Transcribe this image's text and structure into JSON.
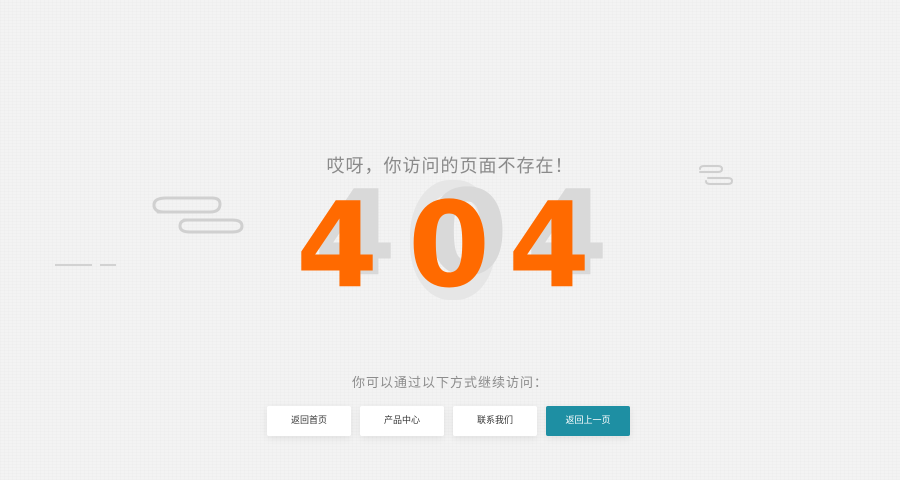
{
  "page": {
    "headline": "哎呀，你访问的页面不存在！",
    "error_code": {
      "digits": [
        "4",
        "0",
        "4"
      ]
    },
    "prompt": "你可以通过以下方式继续访问：",
    "buttons": {
      "home": "返回首页",
      "products": "产品中心",
      "contact": "联系我们",
      "back": "返回上一页"
    }
  },
  "colors": {
    "background": "#f3f3f3",
    "accent": "#ff6a00",
    "primary_button": "#1e8fa3",
    "muted_text": "#8a8a8a"
  },
  "icons": {
    "left_cloud": "cloud-line-icon",
    "right_cloud": "cloud-line-icon",
    "left_dash": "dash-line-icon"
  }
}
